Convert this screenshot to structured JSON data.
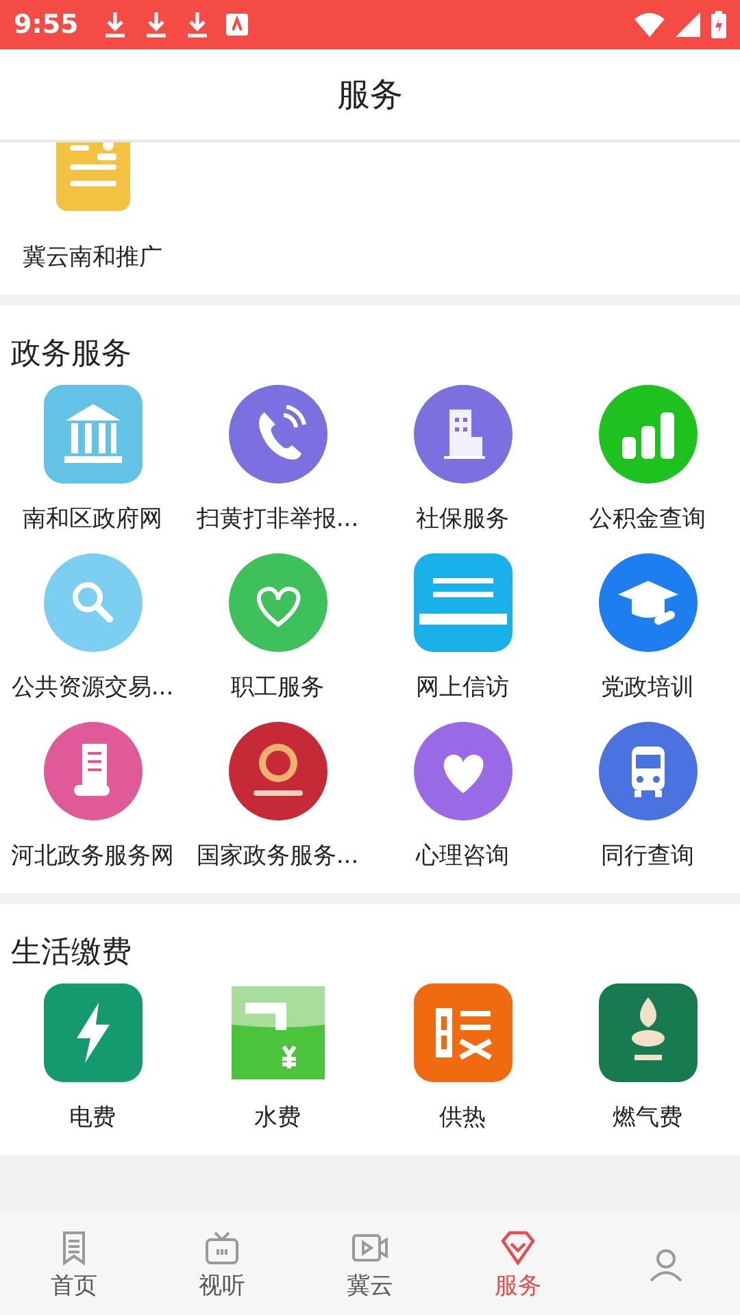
{
  "status_bar": {
    "time": "9:55"
  },
  "header": {
    "title": "服务"
  },
  "top_section": {
    "items": [
      {
        "label": "冀云南和推广"
      }
    ]
  },
  "sections": [
    {
      "title": "政务服务",
      "items": [
        {
          "label": "南和区政府网"
        },
        {
          "label": "扫黄打非举报..."
        },
        {
          "label": "社保服务"
        },
        {
          "label": "公积金查询"
        },
        {
          "label": "公共资源交易..."
        },
        {
          "label": "职工服务"
        },
        {
          "label": "网上信访"
        },
        {
          "label": "党政培训"
        },
        {
          "label": "河北政务服务网"
        },
        {
          "label": "国家政务服务..."
        },
        {
          "label": "心理咨询"
        },
        {
          "label": "同行查询"
        }
      ]
    },
    {
      "title": "生活缴费",
      "items": [
        {
          "label": "电费"
        },
        {
          "label": "水费"
        },
        {
          "label": "供热"
        },
        {
          "label": "燃气费"
        }
      ]
    }
  ],
  "bottom_nav": [
    {
      "label": "首页",
      "selected": false
    },
    {
      "label": "视听",
      "selected": false
    },
    {
      "label": "冀云",
      "selected": false
    },
    {
      "label": "服务",
      "selected": true
    },
    {
      "selected": false
    }
  ]
}
